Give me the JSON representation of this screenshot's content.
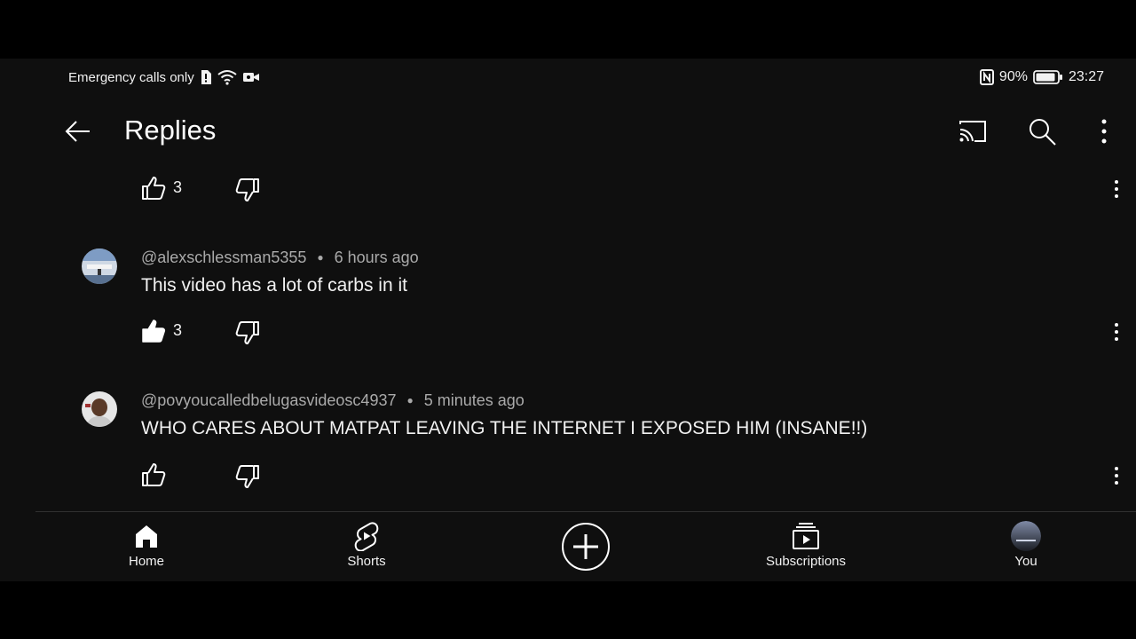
{
  "status": {
    "left_text": "Emergency calls only",
    "battery": "90%",
    "time": "23:27"
  },
  "appbar": {
    "title": "Replies"
  },
  "top_actions": {
    "like_count": "3"
  },
  "comments": [
    {
      "author": "@alexschlessman5355",
      "time": "6 hours ago",
      "text": "This video has a lot of carbs in it",
      "like_count": "3"
    },
    {
      "author": "@povyoucalledbelugasvideosc4937",
      "time": "5 minutes ago",
      "text": "WHO CARES ABOUT MATPAT LEAVING THE INTERNET I EXPOSED HIM (INSANE!!)",
      "like_count": ""
    }
  ],
  "nav": {
    "home": "Home",
    "shorts": "Shorts",
    "subscriptions": "Subscriptions",
    "you": "You"
  },
  "icons": [
    "arrow-left-icon",
    "cast-icon",
    "search-icon",
    "more-vert-icon",
    "thumb-up-icon",
    "thumb-down-icon",
    "home-icon",
    "shorts-icon",
    "create-icon",
    "subscriptions-icon"
  ],
  "colors": {
    "background": "#0f0f0f",
    "text": "#f1f1f1",
    "secondary": "#aaaaaa"
  }
}
